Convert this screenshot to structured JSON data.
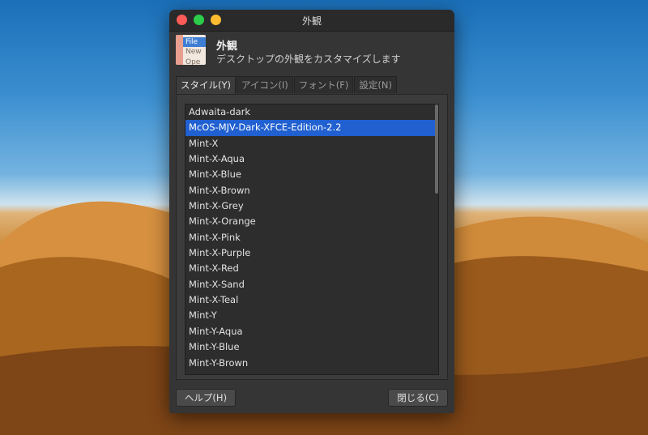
{
  "window": {
    "title": "外観"
  },
  "header": {
    "title": "外観",
    "subtitle": "デスクトップの外観をカスタマイズします",
    "icon_lines": [
      "File",
      "New",
      "Ope"
    ]
  },
  "tabs": [
    {
      "label": "スタイル(Y)",
      "active": true
    },
    {
      "label": "アイコン(I)",
      "active": false
    },
    {
      "label": "フォント(F)",
      "active": false
    },
    {
      "label": "設定(N)",
      "active": false
    }
  ],
  "themes": [
    "Adwaita-dark",
    "McOS-MJV-Dark-XFCE-Edition-2.2",
    "Mint-X",
    "Mint-X-Aqua",
    "Mint-X-Blue",
    "Mint-X-Brown",
    "Mint-X-Grey",
    "Mint-X-Orange",
    "Mint-X-Pink",
    "Mint-X-Purple",
    "Mint-X-Red",
    "Mint-X-Sand",
    "Mint-X-Teal",
    "Mint-Y",
    "Mint-Y-Aqua",
    "Mint-Y-Blue",
    "Mint-Y-Brown"
  ],
  "selected_theme": "McOS-MJV-Dark-XFCE-Edition-2.2",
  "buttons": {
    "help": "ヘルプ(H)",
    "close": "閉じる(C)"
  },
  "colors": {
    "selection": "#2060d0",
    "window_bg": "#353535"
  }
}
